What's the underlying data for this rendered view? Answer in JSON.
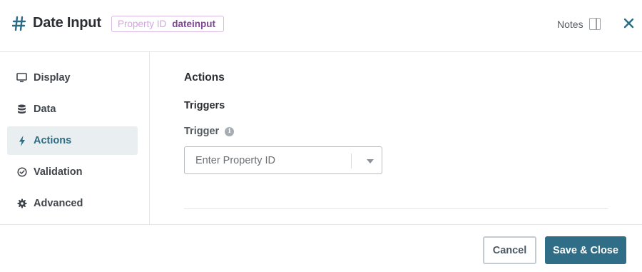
{
  "header": {
    "title": "Date Input",
    "property_badge": {
      "label": "Property ID",
      "value": "dateinput"
    },
    "notes_label": "Notes"
  },
  "sidebar": {
    "items": [
      {
        "label": "Display",
        "icon": "monitor-icon",
        "active": false
      },
      {
        "label": "Data",
        "icon": "database-icon",
        "active": false
      },
      {
        "label": "Actions",
        "icon": "lightning-icon",
        "active": true
      },
      {
        "label": "Validation",
        "icon": "check-circle-icon",
        "active": false
      },
      {
        "label": "Advanced",
        "icon": "gear-icon",
        "active": false
      }
    ]
  },
  "main": {
    "heading": "Actions",
    "section_title": "Triggers",
    "trigger_label": "Trigger",
    "trigger_select": {
      "placeholder": "Enter Property ID"
    }
  },
  "footer": {
    "cancel_label": "Cancel",
    "save_label": "Save & Close"
  },
  "colors": {
    "accent": "#2f6e86",
    "active_nav_bg": "#e9eef1",
    "badge_border": "#d9b8e4",
    "badge_value": "#7d4692"
  }
}
